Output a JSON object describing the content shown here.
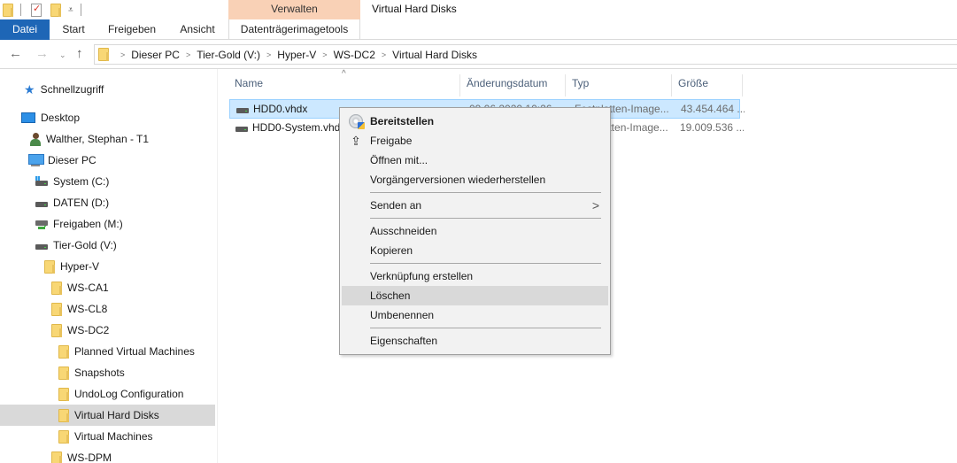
{
  "window": {
    "title": "Virtual Hard Disks",
    "context_group": "Verwalten"
  },
  "quick_access_toolbar": {
    "icons": [
      "folder-icon",
      "properties-icon",
      "new-folder-icon",
      "customize-dropdown-icon"
    ]
  },
  "ribbon": {
    "tabs": [
      {
        "label": "Datei",
        "active": true
      },
      {
        "label": "Start"
      },
      {
        "label": "Freigeben"
      },
      {
        "label": "Ansicht"
      },
      {
        "label": "Datenträgerimagetools"
      }
    ]
  },
  "navigation": {
    "back": "←",
    "forward": "→",
    "recent": "⌄",
    "up": "↑",
    "breadcrumb": [
      "Dieser PC",
      "Tier-Gold (V:)",
      "Hyper-V",
      "WS-DC2",
      "Virtual Hard Disks"
    ],
    "separator": ">"
  },
  "nav_pane": {
    "items": [
      {
        "label": "Schnellzugriff",
        "icon": "quick-access-star-icon"
      },
      {
        "label": "Desktop",
        "icon": "desktop-icon"
      },
      {
        "label": "Walther, Stephan - T1",
        "icon": "user-folder-icon"
      },
      {
        "label": "Dieser PC",
        "icon": "this-pc-icon"
      },
      {
        "label": "System (C:)",
        "icon": "system-drive-icon"
      },
      {
        "label": "DATEN (D:)",
        "icon": "drive-icon"
      },
      {
        "label": "Freigaben (M:)",
        "icon": "network-drive-icon"
      },
      {
        "label": "Tier-Gold (V:)",
        "icon": "drive-icon"
      },
      {
        "label": "Hyper-V",
        "icon": "folder-icon"
      },
      {
        "label": "WS-CA1",
        "icon": "folder-icon"
      },
      {
        "label": "WS-CL8",
        "icon": "folder-icon"
      },
      {
        "label": "WS-DC2",
        "icon": "folder-icon"
      },
      {
        "label": "Planned Virtual Machines",
        "icon": "folder-icon"
      },
      {
        "label": "Snapshots",
        "icon": "folder-icon"
      },
      {
        "label": "UndoLog Configuration",
        "icon": "folder-icon"
      },
      {
        "label": "Virtual Hard Disks",
        "icon": "folder-icon",
        "selected": true
      },
      {
        "label": "Virtual Machines",
        "icon": "folder-icon"
      },
      {
        "label": "WS-DPM",
        "icon": "folder-icon"
      }
    ]
  },
  "file_list": {
    "sort_indicator": "^",
    "columns": [
      "Name",
      "Änderungsdatum",
      "Typ",
      "Größe"
    ],
    "rows": [
      {
        "name": "HDD0.vhdx",
        "date": "09.06.2020 10:26",
        "type": "Festplatten-Image...",
        "size": "43.454.464 ...",
        "selected": true
      },
      {
        "name": "HDD0-System.vhdx",
        "date": "",
        "type": "Festplatten-Image...",
        "size": "19.009.536 ..."
      }
    ]
  },
  "context_menu": {
    "items": [
      {
        "label": "Bereitstellen",
        "bold": true,
        "icon": "mount-disc-icon"
      },
      {
        "label": "Freigabe",
        "icon": "share-icon"
      },
      {
        "label": "Öffnen mit..."
      },
      {
        "label": "Vorgängerversionen wiederherstellen"
      },
      {
        "label": "Senden an",
        "submenu": true
      },
      {
        "label": "Ausschneiden"
      },
      {
        "label": "Kopieren"
      },
      {
        "label": "Verknüpfung erstellen"
      },
      {
        "label": "Löschen",
        "hover": true
      },
      {
        "label": "Umbenennen"
      },
      {
        "label": "Eigenschaften"
      }
    ],
    "submenu_arrow": ">"
  },
  "colors": {
    "file_tab": "#1e66b6",
    "context_group": "#f9d1b6",
    "selection": "#cce8ff",
    "selection_border": "#99d1ff",
    "nav_selected": "#d9d9d9"
  }
}
